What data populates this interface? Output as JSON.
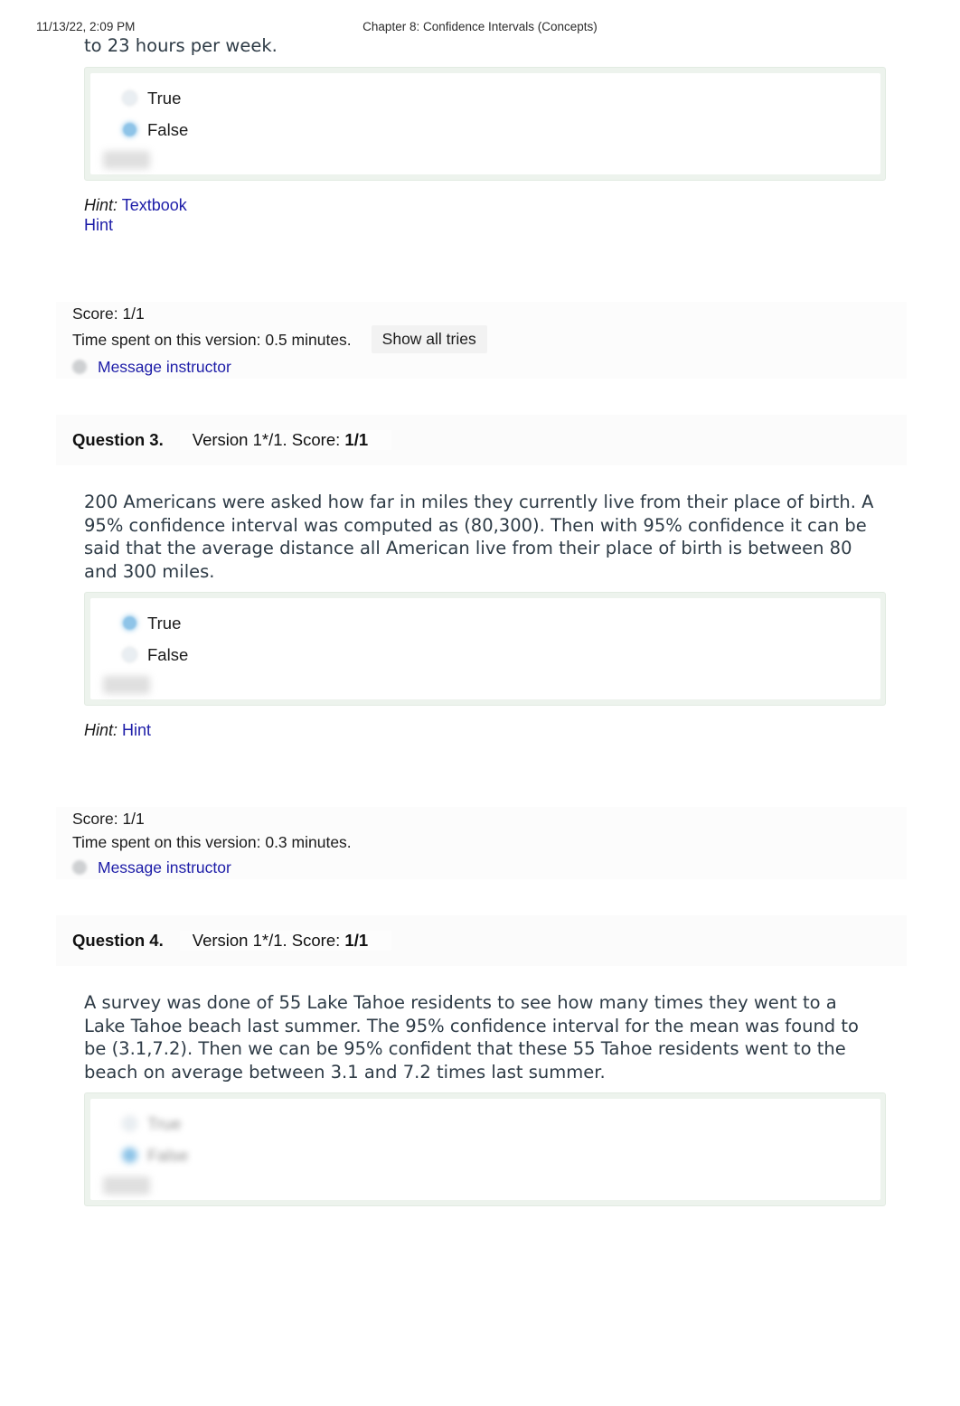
{
  "print_header": {
    "date": "11/13/22, 2:09 PM",
    "title": "Chapter 8: Confidence Intervals (Concepts)"
  },
  "continued_text": "to 23 hours per week.",
  "colors": {
    "link": "#1d1da8",
    "answer_box_bg": "#edf3ed",
    "radio_selected": "#8ec4e8",
    "text": "#2e3b46"
  },
  "question2_tail": {
    "options": [
      {
        "label": "True",
        "selected": false
      },
      {
        "label": "False",
        "selected": true
      }
    ],
    "hint_label": "Hint:",
    "hint_links": [
      "Textbook",
      "Hint"
    ],
    "score": "Score: 1/1",
    "time_spent": "Time spent on this version: 0.5 minutes.",
    "show_all_tries": "Show all tries",
    "message_instructor": "Message instructor"
  },
  "question3": {
    "number": "Question 3.",
    "version": "Version 1*/1. Score: ",
    "version_score": "1/1",
    "prompt": "200 Americans were asked how far in miles they currently live from their place of birth. A 95% confidence interval was computed as (80,300). Then with 95% confidence it can be said that the average distance all American live from their place of birth is between 80 and 300 miles.",
    "options": [
      {
        "label": "True",
        "selected": true
      },
      {
        "label": "False",
        "selected": false
      }
    ],
    "hint_label": "Hint:",
    "hint_links": [
      "Hint"
    ],
    "score": "Score: 1/1",
    "time_spent": "Time spent on this version: 0.3 minutes.",
    "message_instructor": "Message instructor"
  },
  "question4": {
    "number": "Question 4.",
    "version": "Version 1*/1. Score: ",
    "version_score": "1/1",
    "prompt": "A survey was done of 55 Lake Tahoe residents to see how many times they went to a Lake Tahoe beach last summer. The 95% confidence interval for the mean was found to be (3.1,7.2). Then we can be 95% confident that these 55 Tahoe residents went to the beach on average between 3.1 and 7.2 times last summer.",
    "options": [
      {
        "label": "True",
        "selected": false
      },
      {
        "label": "False",
        "selected": true
      }
    ]
  }
}
